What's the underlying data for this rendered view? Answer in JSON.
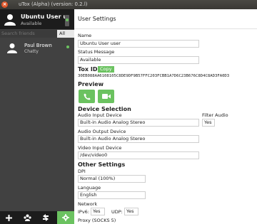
{
  "window": {
    "title": "uTox (Alpha) (version: 0.2.l)"
  },
  "self": {
    "name": "Ubuntu User u...",
    "status": "Available"
  },
  "search": {
    "placeholder": "Search friends",
    "filter_label": "All"
  },
  "friends": [
    {
      "name": "Paul Brown",
      "status": "Chatty"
    }
  ],
  "settings": {
    "title": "User Settings",
    "name_label": "Name",
    "name_value": "Ubuntu User user",
    "status_label": "Status Message",
    "status_value": "Available",
    "toxid_label": "Tox ID",
    "copy_label": "Copy",
    "toxid_value": "30EB088AA6108105C8DE9DF9B57FFC203FCBB1A7D6C23B676C8D4C8AD3FA0D3",
    "preview_heading": "Preview",
    "device_heading": "Device Selection",
    "audio_input_label": "Audio Input Device",
    "audio_input_value": "Built-in Audio Analog Stereo",
    "filter_audio_label": "Filter Audio",
    "filter_audio_value": "Yes",
    "audio_output_label": "Audio Output Device",
    "audio_output_value": "Built-in Audio Analog Stereo",
    "video_input_label": "Video Input Device",
    "video_input_value": "/dev/video0",
    "other_heading": "Other Settings",
    "dpi_label": "DPI",
    "dpi_value": "Normal (100%)",
    "language_label": "Language",
    "language_value": "English",
    "network_label": "Network",
    "ipv6_label": "IPv6:",
    "ipv6_value": "Yes",
    "udp_label": "UDP:",
    "udp_value": "Yes",
    "proxy_label": "Proxy (SOCKS 5)"
  },
  "colors": {
    "accent": "#6bc260",
    "sidebar": "#414141",
    "header_dark": "#1c1c1c"
  },
  "icons": {
    "sidebar_bottom": [
      "plus-icon",
      "group-icon",
      "transfer-icon",
      "gear-icon"
    ],
    "preview": [
      "phone-icon",
      "video-icon"
    ]
  }
}
